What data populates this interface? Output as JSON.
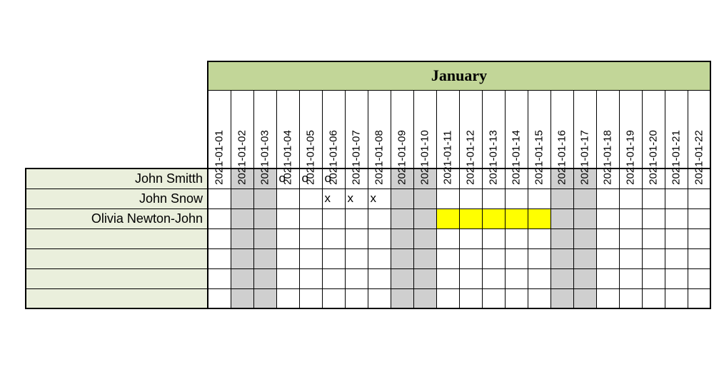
{
  "month_label": "January",
  "dates": [
    "2021-01-01",
    "2021-01-02",
    "2021-01-03",
    "2021-01-04",
    "2021-01-05",
    "2021-01-06",
    "2021-01-07",
    "2021-01-08",
    "2021-01-09",
    "2021-01-10",
    "2021-01-11",
    "2021-01-12",
    "2021-01-13",
    "2021-01-14",
    "2021-01-15",
    "2021-01-16",
    "2021-01-17",
    "2021-01-18",
    "2021-01-19",
    "2021-01-20",
    "2021-01-21",
    "2021-01-22"
  ],
  "grey_columns": [
    1,
    2,
    8,
    9,
    15,
    16
  ],
  "rows": [
    {
      "name": "John Smitth",
      "cells": [
        "",
        "",
        "",
        "o",
        "o",
        "o",
        "",
        "",
        "",
        "",
        "",
        "",
        "",
        "",
        "",
        "",
        "",
        "",
        "",
        "",
        "",
        ""
      ],
      "yellow": []
    },
    {
      "name": "John Snow",
      "cells": [
        "",
        "",
        "",
        "",
        "",
        "x",
        "x",
        "x",
        "",
        "",
        "",
        "",
        "",
        "",
        "",
        "",
        "",
        "",
        "",
        "",
        "",
        ""
      ],
      "yellow": []
    },
    {
      "name": "Olivia Newton-John",
      "cells": [
        "",
        "",
        "",
        "",
        "",
        "",
        "",
        "",
        "",
        "",
        "",
        "",
        "",
        "",
        "",
        "",
        "",
        "",
        "",
        "",
        "",
        ""
      ],
      "yellow": [
        10,
        11,
        12,
        13,
        14
      ]
    },
    {
      "name": "",
      "cells": [
        "",
        "",
        "",
        "",
        "",
        "",
        "",
        "",
        "",
        "",
        "",
        "",
        "",
        "",
        "",
        "",
        "",
        "",
        "",
        "",
        "",
        ""
      ],
      "yellow": []
    },
    {
      "name": "",
      "cells": [
        "",
        "",
        "",
        "",
        "",
        "",
        "",
        "",
        "",
        "",
        "",
        "",
        "",
        "",
        "",
        "",
        "",
        "",
        "",
        "",
        "",
        ""
      ],
      "yellow": []
    },
    {
      "name": "",
      "cells": [
        "",
        "",
        "",
        "",
        "",
        "",
        "",
        "",
        "",
        "",
        "",
        "",
        "",
        "",
        "",
        "",
        "",
        "",
        "",
        "",
        "",
        ""
      ],
      "yellow": []
    },
    {
      "name": "",
      "cells": [
        "",
        "",
        "",
        "",
        "",
        "",
        "",
        "",
        "",
        "",
        "",
        "",
        "",
        "",
        "",
        "",
        "",
        "",
        "",
        "",
        "",
        ""
      ],
      "yellow": []
    }
  ],
  "chart_data": {
    "type": "table",
    "title": "January",
    "columns": [
      "2021-01-01",
      "2021-01-02",
      "2021-01-03",
      "2021-01-04",
      "2021-01-05",
      "2021-01-06",
      "2021-01-07",
      "2021-01-08",
      "2021-01-09",
      "2021-01-10",
      "2021-01-11",
      "2021-01-12",
      "2021-01-13",
      "2021-01-14",
      "2021-01-15",
      "2021-01-16",
      "2021-01-17",
      "2021-01-18",
      "2021-01-19",
      "2021-01-20",
      "2021-01-21",
      "2021-01-22"
    ],
    "row_labels": [
      "John Smitth",
      "John Snow",
      "Olivia Newton-John",
      "",
      "",
      "",
      ""
    ],
    "values": [
      [
        "",
        "",
        "",
        "o",
        "o",
        "o",
        "",
        "",
        "",
        "",
        "",
        "",
        "",
        "",
        "",
        "",
        "",
        "",
        "",
        "",
        "",
        ""
      ],
      [
        "",
        "",
        "",
        "",
        "",
        "x",
        "x",
        "x",
        "",
        "",
        "",
        "",
        "",
        "",
        "",
        "",
        "",
        "",
        "",
        "",
        "",
        ""
      ],
      [
        "",
        "",
        "",
        "",
        "",
        "",
        "",
        "",
        "",
        "",
        "",
        "",
        "",
        "",
        "",
        "",
        "",
        "",
        "",
        "",
        "",
        ""
      ],
      [
        "",
        "",
        "",
        "",
        "",
        "",
        "",
        "",
        "",
        "",
        "",
        "",
        "",
        "",
        "",
        "",
        "",
        "",
        "",
        "",
        "",
        ""
      ],
      [
        "",
        "",
        "",
        "",
        "",
        "",
        "",
        "",
        "",
        "",
        "",
        "",
        "",
        "",
        "",
        "",
        "",
        "",
        "",
        "",
        "",
        ""
      ],
      [
        "",
        "",
        "",
        "",
        "",
        "",
        "",
        "",
        "",
        "",
        "",
        "",
        "",
        "",
        "",
        "",
        "",
        "",
        "",
        "",
        "",
        ""
      ],
      [
        "",
        "",
        "",
        "",
        "",
        "",
        "",
        "",
        "",
        "",
        "",
        "",
        "",
        "",
        "",
        "",
        "",
        "",
        "",
        "",
        "",
        ""
      ]
    ],
    "highlights": {
      "grey_columns": [
        1,
        2,
        8,
        9,
        15,
        16
      ],
      "yellow_cells": [
        [
          2,
          10
        ],
        [
          2,
          11
        ],
        [
          2,
          12
        ],
        [
          2,
          13
        ],
        [
          2,
          14
        ]
      ]
    }
  }
}
